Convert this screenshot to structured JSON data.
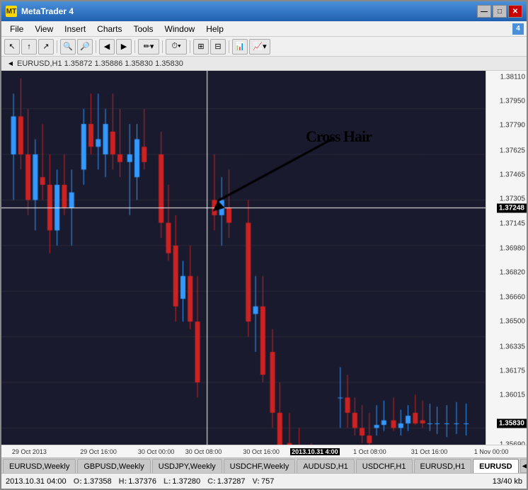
{
  "window": {
    "title": "MetaTrader 4",
    "icon": "MT"
  },
  "titlebar": {
    "title": "MetaTrader 4",
    "minimize_label": "—",
    "maximize_label": "□",
    "close_label": "✕"
  },
  "menubar": {
    "items": [
      "File",
      "View",
      "Insert",
      "Charts",
      "Tools",
      "Window",
      "Help"
    ]
  },
  "toolbar": {
    "badge": "4",
    "buttons": [
      "⇐",
      "↑",
      "🔍+",
      "🔍-",
      "↩",
      "↪",
      "✏",
      "⏱",
      "⊞",
      "⊟"
    ]
  },
  "chart": {
    "header": "EURUSD,H1  1.35872  1.35886  1.35830  1.35830",
    "crosshair_label": "Cross Hair",
    "crosshair_price": "1.37248",
    "crosshair_time": "2013.10.31 4:00",
    "price_levels": [
      "1.38110",
      "1.37950",
      "1.37790",
      "1.37625",
      "1.37465",
      "1.37305",
      "1.37248",
      "1.37145",
      "1.36980",
      "1.36820",
      "1.36660",
      "1.36500",
      "1.36335",
      "1.36175",
      "1.36015",
      "1.35830",
      "1.35690"
    ],
    "time_labels": [
      "29 Oct 2013",
      "29 Oct 16:00",
      "30 Oct 00:00",
      "30 Oct 08:00",
      "30 Oct 16:00",
      "2013.10.31 4:00",
      "1 Oct 08:00",
      "31 Oct 16:00",
      "1 Nov 00:00"
    ]
  },
  "tabs": {
    "items": [
      {
        "label": "EURUSD,Weekly",
        "active": false
      },
      {
        "label": "GBPUSD,Weekly",
        "active": false
      },
      {
        "label": "USDJPY,Weekly",
        "active": false
      },
      {
        "label": "USDCHF,Weekly",
        "active": false
      },
      {
        "label": "AUDUSD,H1",
        "active": false
      },
      {
        "label": "USDCHF,H1",
        "active": false
      },
      {
        "label": "EURUSD,H1",
        "active": false
      },
      {
        "label": "EURUSD",
        "active": true
      }
    ]
  },
  "statusbar": {
    "datetime": "2013.10.31 04:00",
    "open_label": "O:",
    "open_value": "1.37358",
    "high_label": "H:",
    "high_value": "1.37376",
    "low_label": "L:",
    "low_value": "1.37280",
    "close_label": "C:",
    "close_value": "1.37287",
    "volume_label": "V:",
    "volume_value": "757",
    "size_label": "13/40 kb"
  }
}
